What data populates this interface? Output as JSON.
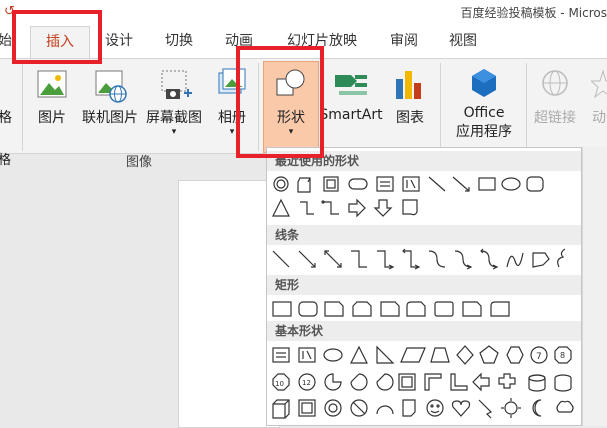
{
  "window": {
    "title": "百度经验投稿模板 - Micros"
  },
  "tabs": [
    {
      "label": "始"
    },
    {
      "label": "插入"
    },
    {
      "label": "设计"
    },
    {
      "label": "切换"
    },
    {
      "label": "动画"
    },
    {
      "label": "幻灯片放映"
    },
    {
      "label": "审阅"
    },
    {
      "label": "视图"
    }
  ],
  "ribbon": {
    "left_cut_label_1": "格",
    "left_cut_label_2": "格",
    "picture": "图片",
    "online_picture": "联机图片",
    "screenshot": "屏幕截图",
    "album": "相册",
    "shapes": "形状",
    "smartart": "SmartArt",
    "chart": "图表",
    "office_apps_1": "Office",
    "office_apps_2": "应用程序",
    "hyperlink": "超链接",
    "action": "动作",
    "group_images": "图像"
  },
  "gallery": {
    "recent": "最近使用的形状",
    "lines": "线条",
    "rectangles": "矩形",
    "basic": "基本形状"
  },
  "colors": {
    "accent": "#c43e1c",
    "annotation": "#e8202a"
  }
}
